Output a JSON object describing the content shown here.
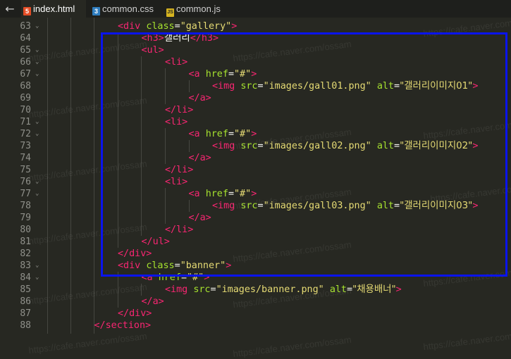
{
  "tabs": [
    {
      "label": "index.html",
      "icon": "html5-file-icon",
      "badge": "5",
      "badge_color": "#e44d26",
      "active": true
    },
    {
      "label": "common.css",
      "icon": "css3-file-icon",
      "badge": "3",
      "badge_color": "#2f7dbf",
      "active": false
    },
    {
      "label": "common.js",
      "icon": "js-file-icon",
      "badge": "JS",
      "badge_color": "#d5b320",
      "active": false
    }
  ],
  "back_arrow": "←",
  "watermark": "https://cafe.naver.com/ossam",
  "colors": {
    "background": "#272822",
    "tag": "#f92672",
    "attribute": "#a6e22e",
    "string": "#e6db74",
    "text": "#f8f8f2",
    "line_number": "#8f908a",
    "highlight_box": "#0a14ee"
  },
  "lines": [
    {
      "num": "63",
      "fold": "⌄",
      "indent": 2,
      "tokens": [
        [
          "tg",
          "<div"
        ],
        [
          "tx",
          " "
        ],
        [
          "at",
          "class"
        ],
        [
          "eq",
          "="
        ],
        [
          "st",
          "\"gallery\""
        ],
        [
          "tg",
          ">"
        ]
      ]
    },
    {
      "num": "64",
      "fold": "",
      "indent": 3,
      "tokens": [
        [
          "tg",
          "<h3>"
        ],
        [
          "tx",
          "갤러리"
        ],
        [
          "tg",
          "</h3>"
        ]
      ]
    },
    {
      "num": "65",
      "fold": "⌄",
      "indent": 3,
      "tokens": [
        [
          "tg",
          "<ul>"
        ]
      ]
    },
    {
      "num": "66",
      "fold": "⌄",
      "indent": 4,
      "tokens": [
        [
          "tg",
          "<li>"
        ]
      ]
    },
    {
      "num": "67",
      "fold": "⌄",
      "indent": 5,
      "tokens": [
        [
          "tg",
          "<a"
        ],
        [
          "tx",
          " "
        ],
        [
          "at",
          "href"
        ],
        [
          "eq",
          "="
        ],
        [
          "st",
          "\"#\""
        ],
        [
          "tg",
          ">"
        ]
      ]
    },
    {
      "num": "68",
      "fold": "",
      "indent": 6,
      "tokens": [
        [
          "tg",
          "<img"
        ],
        [
          "tx",
          " "
        ],
        [
          "at",
          "src"
        ],
        [
          "eq",
          "="
        ],
        [
          "st",
          "\"images/gall01.png\""
        ],
        [
          "tx",
          " "
        ],
        [
          "at",
          "alt"
        ],
        [
          "eq",
          "="
        ],
        [
          "st",
          "\"갤러리이미지01\""
        ],
        [
          "tg",
          ">"
        ]
      ]
    },
    {
      "num": "69",
      "fold": "",
      "indent": 5,
      "tokens": [
        [
          "tg",
          "</a>"
        ]
      ]
    },
    {
      "num": "70",
      "fold": "",
      "indent": 4,
      "tokens": [
        [
          "tg",
          "</li>"
        ]
      ]
    },
    {
      "num": "71",
      "fold": "⌄",
      "indent": 4,
      "tokens": [
        [
          "tg",
          "<li>"
        ]
      ]
    },
    {
      "num": "72",
      "fold": "⌄",
      "indent": 5,
      "tokens": [
        [
          "tg",
          "<a"
        ],
        [
          "tx",
          " "
        ],
        [
          "at",
          "href"
        ],
        [
          "eq",
          "="
        ],
        [
          "st",
          "\"#\""
        ],
        [
          "tg",
          ">"
        ]
      ]
    },
    {
      "num": "73",
      "fold": "",
      "indent": 6,
      "tokens": [
        [
          "tg",
          "<img"
        ],
        [
          "tx",
          " "
        ],
        [
          "at",
          "src"
        ],
        [
          "eq",
          "="
        ],
        [
          "st",
          "\"images/gall02.png\""
        ],
        [
          "tx",
          " "
        ],
        [
          "at",
          "alt"
        ],
        [
          "eq",
          "="
        ],
        [
          "st",
          "\"갤러리이미지02\""
        ],
        [
          "tg",
          ">"
        ]
      ]
    },
    {
      "num": "74",
      "fold": "",
      "indent": 5,
      "tokens": [
        [
          "tg",
          "</a>"
        ]
      ]
    },
    {
      "num": "75",
      "fold": "",
      "indent": 4,
      "tokens": [
        [
          "tg",
          "</li>"
        ]
      ]
    },
    {
      "num": "76",
      "fold": "⌄",
      "indent": 4,
      "tokens": [
        [
          "tg",
          "<li>"
        ]
      ]
    },
    {
      "num": "77",
      "fold": "⌄",
      "indent": 5,
      "tokens": [
        [
          "tg",
          "<a"
        ],
        [
          "tx",
          " "
        ],
        [
          "at",
          "href"
        ],
        [
          "eq",
          "="
        ],
        [
          "st",
          "\"#\""
        ],
        [
          "tg",
          ">"
        ]
      ]
    },
    {
      "num": "78",
      "fold": "",
      "indent": 6,
      "tokens": [
        [
          "tg",
          "<img"
        ],
        [
          "tx",
          " "
        ],
        [
          "at",
          "src"
        ],
        [
          "eq",
          "="
        ],
        [
          "st",
          "\"images/gall03.png\""
        ],
        [
          "tx",
          " "
        ],
        [
          "at",
          "alt"
        ],
        [
          "eq",
          "="
        ],
        [
          "st",
          "\"갤러리이미지03\""
        ],
        [
          "tg",
          ">"
        ]
      ]
    },
    {
      "num": "79",
      "fold": "",
      "indent": 5,
      "tokens": [
        [
          "tg",
          "</a>"
        ]
      ]
    },
    {
      "num": "80",
      "fold": "",
      "indent": 4,
      "tokens": [
        [
          "tg",
          "</li>"
        ]
      ]
    },
    {
      "num": "81",
      "fold": "",
      "indent": 3,
      "tokens": [
        [
          "tg",
          "</ul>"
        ]
      ]
    },
    {
      "num": "82",
      "fold": "",
      "indent": 2,
      "tokens": [
        [
          "tg",
          "</div>"
        ]
      ]
    },
    {
      "num": "83",
      "fold": "⌄",
      "indent": 2,
      "tokens": [
        [
          "tg",
          "<div"
        ],
        [
          "tx",
          " "
        ],
        [
          "at",
          "class"
        ],
        [
          "eq",
          "="
        ],
        [
          "st",
          "\"banner\""
        ],
        [
          "tg",
          ">"
        ]
      ]
    },
    {
      "num": "84",
      "fold": "⌄",
      "indent": 3,
      "tokens": [
        [
          "tg",
          "<a"
        ],
        [
          "tx",
          " "
        ],
        [
          "at",
          "href"
        ],
        [
          "eq",
          "="
        ],
        [
          "st",
          "\"#\""
        ],
        [
          "tg",
          ">"
        ]
      ]
    },
    {
      "num": "85",
      "fold": "",
      "indent": 4,
      "tokens": [
        [
          "tg",
          "<img"
        ],
        [
          "tx",
          " "
        ],
        [
          "at",
          "src"
        ],
        [
          "eq",
          "="
        ],
        [
          "st",
          "\"images/banner.png\""
        ],
        [
          "tx",
          " "
        ],
        [
          "at",
          "alt"
        ],
        [
          "eq",
          "="
        ],
        [
          "st",
          "\"채용배너\""
        ],
        [
          "tg",
          ">"
        ]
      ]
    },
    {
      "num": "86",
      "fold": "",
      "indent": 3,
      "tokens": [
        [
          "tg",
          "</a>"
        ]
      ]
    },
    {
      "num": "87",
      "fold": "",
      "indent": 2,
      "tokens": [
        [
          "tg",
          "</div>"
        ]
      ]
    },
    {
      "num": "88",
      "fold": "",
      "indent": 1,
      "tokens": [
        [
          "tg",
          "</section>"
        ]
      ]
    }
  ]
}
